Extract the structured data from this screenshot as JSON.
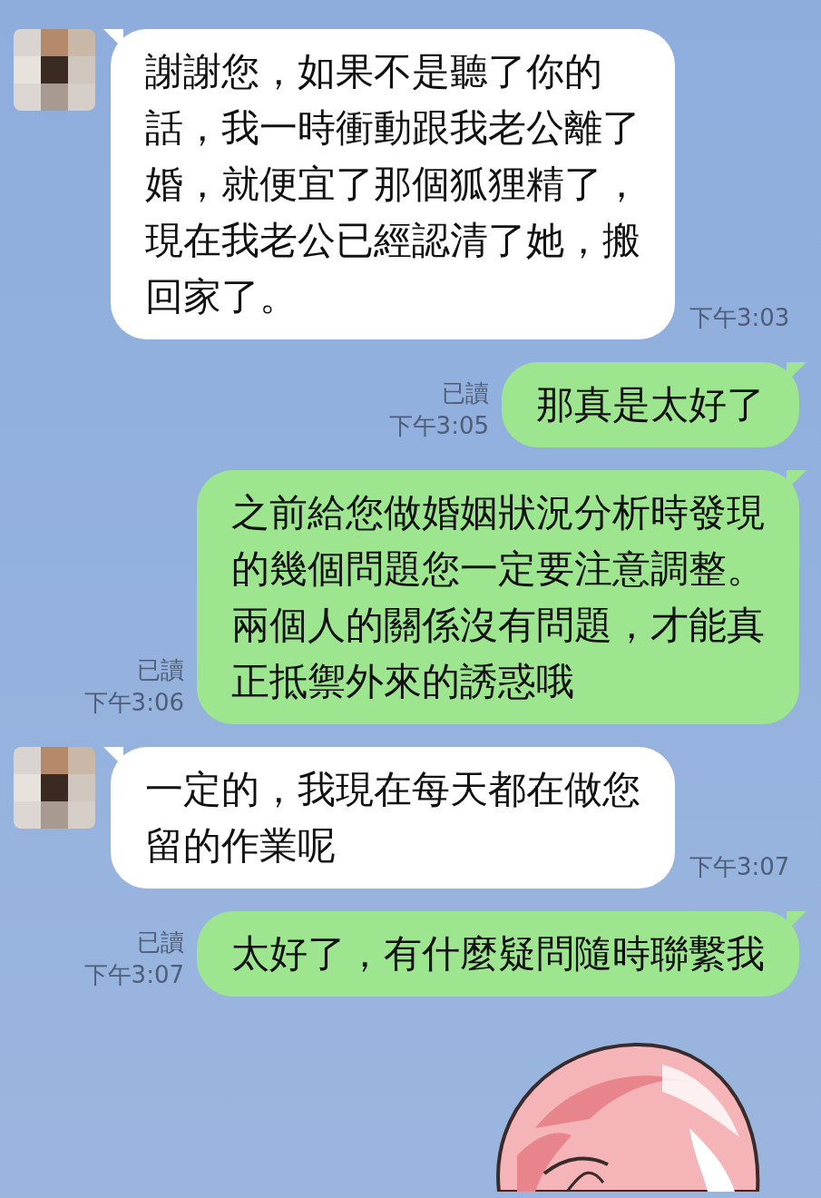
{
  "messages": [
    {
      "kind": "incoming",
      "text": "謝謝您，如果不是聽了你的話，我一時衝動跟我老公離了婚，就便宜了那個狐狸精了，現在我老公已經認清了她，搬回家了。",
      "time": "下午3:03"
    },
    {
      "kind": "outgoing",
      "text": "那真是太好了",
      "read_label": "已讀",
      "time": "下午3:05"
    },
    {
      "kind": "outgoing",
      "text": "之前給您做婚姻狀況分析時發現的幾個問題您一定要注意調整。兩個人的關係沒有問題，才能真正抵禦外來的誘惑哦",
      "read_label": "已讀",
      "time": "下午3:06"
    },
    {
      "kind": "incoming",
      "text": "一定的，我現在每天都在做您留的作業呢",
      "time": "下午3:07"
    },
    {
      "kind": "outgoing",
      "text": "太好了，有什麼疑問隨時聯繫我",
      "read_label": "已讀",
      "time": "下午3:07"
    }
  ]
}
